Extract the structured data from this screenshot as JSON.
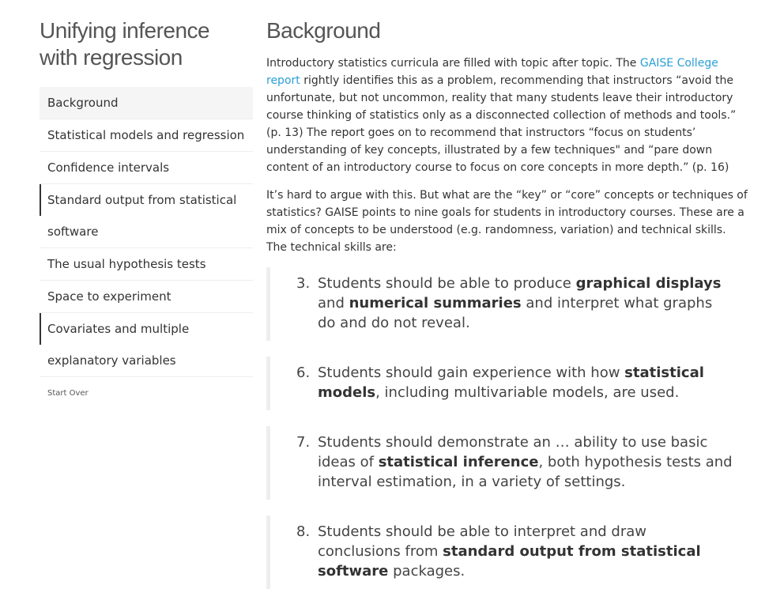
{
  "sidebar": {
    "title": "Unifying inference with regression",
    "items": [
      {
        "label": "Background"
      },
      {
        "label": "Statistical models and regression"
      },
      {
        "label": "Confidence intervals"
      },
      {
        "label": "Standard output from statistical",
        "label2": "software"
      },
      {
        "label": "The usual hypothesis tests"
      },
      {
        "label": "Space to experiment"
      },
      {
        "label": "Covariates and multiple",
        "label2": "explanatory variables"
      }
    ],
    "start_over": "Start Over"
  },
  "main": {
    "section_title": "Background",
    "p1": {
      "pre": "Introductory statistics curricula are filled with topic after topic. The ",
      "link": "GAISE College report",
      "post": " rightly identifies this as a problem, recommending that instructors “avoid the unfortunate, but not uncommon, reality that many students leave their introductory course thinking of statistics only as a disconnected collection of methods and tools.” (p. 13) The report goes on to recommend that instructors “focus on students’ understanding of key concepts, illustrated by a few techniques\" and “pare down content of an introductory course to focus on core concepts in more depth.” (p. 16)"
    },
    "p2": "It’s hard to argue with this. But what are the “key” or “core” concepts or techniques of statistics? GAISE points to nine goals for students in introductory courses. These are a mix of concepts to be understood (e.g. randomness, variation) and technical skills. The technical skills are:",
    "goals": [
      {
        "num": "3.",
        "t1": "Students should be able to produce ",
        "b1": "graphical displays",
        "t2": " and ",
        "b2": "numerical summaries",
        "t3": " and interpret what graphs do and do not reveal."
      },
      {
        "num": "6.",
        "t1": "Students should gain experience with how ",
        "b1": "statistical models",
        "t2": ", including multivariable models, are used."
      },
      {
        "num": "7.",
        "t1": "Students should demonstrate an … ability to use basic ideas of ",
        "b1": "statistical inference",
        "t2": ", both hypothesis tests and interval estimation, in a variety of settings."
      },
      {
        "num": "8.",
        "t1": "Students should be able to interpret and draw conclusions from ",
        "b1": "standard output from statistical software",
        "t2": " packages."
      }
    ]
  }
}
